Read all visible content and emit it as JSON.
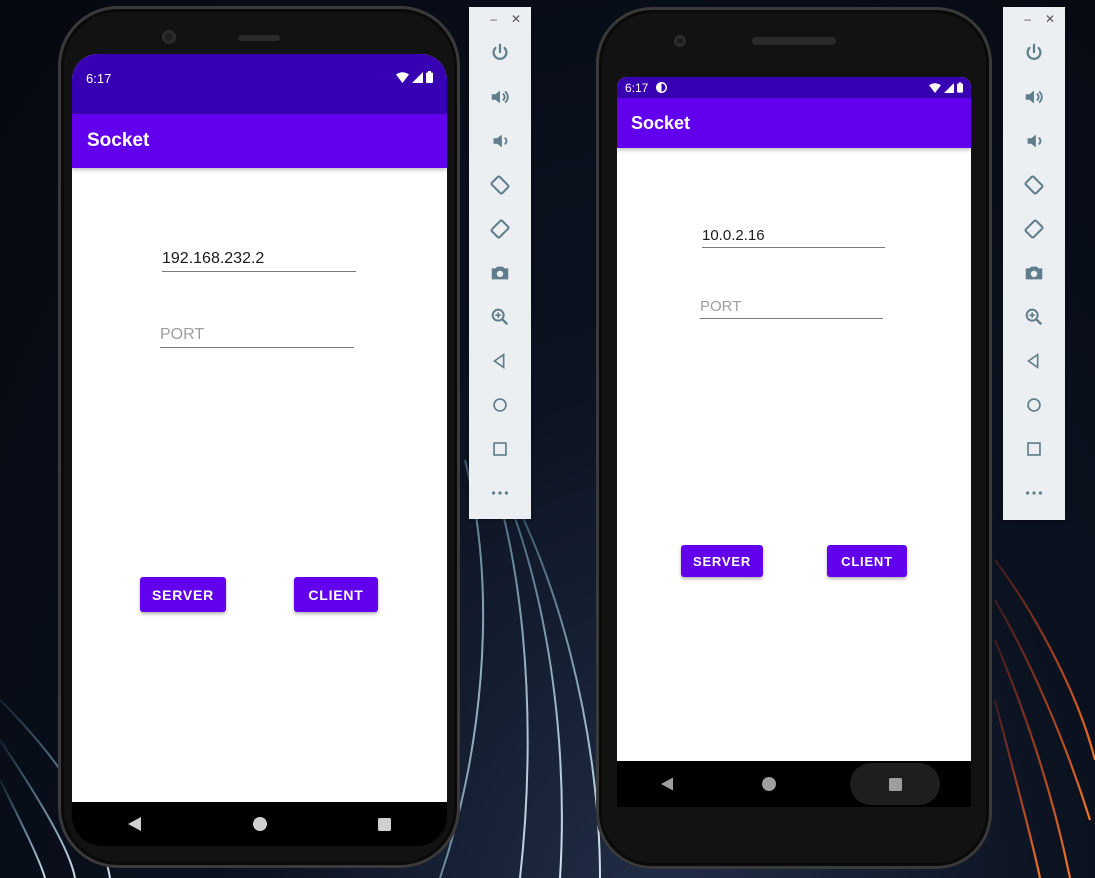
{
  "colors": {
    "primary": "#6200ee",
    "primary_dark": "#3700b3",
    "white": "#ffffff",
    "hint": "#9e9e9e"
  },
  "emulators": [
    {
      "status": {
        "time": "6:17"
      },
      "app": {
        "title": "Socket"
      },
      "ip_field": {
        "value": "192.168.232.2"
      },
      "port_field": {
        "placeholder": "PORT"
      },
      "buttons": {
        "server": "SERVER",
        "client": "CLIENT"
      }
    },
    {
      "status": {
        "time": "6:17"
      },
      "app": {
        "title": "Socket"
      },
      "ip_field": {
        "value": "10.0.2.16"
      },
      "port_field": {
        "placeholder": "PORT"
      },
      "buttons": {
        "server": "SERVER",
        "client": "CLIENT"
      }
    }
  ],
  "toolbar": {
    "window_controls": {
      "minimize": "–",
      "close": "✕"
    },
    "icons": [
      "power-icon",
      "volume-up-icon",
      "volume-down-icon",
      "rotate-left-icon",
      "rotate-right-icon",
      "camera-icon",
      "zoom-icon",
      "back-icon",
      "home-icon",
      "overview-icon",
      "more-icon"
    ]
  }
}
